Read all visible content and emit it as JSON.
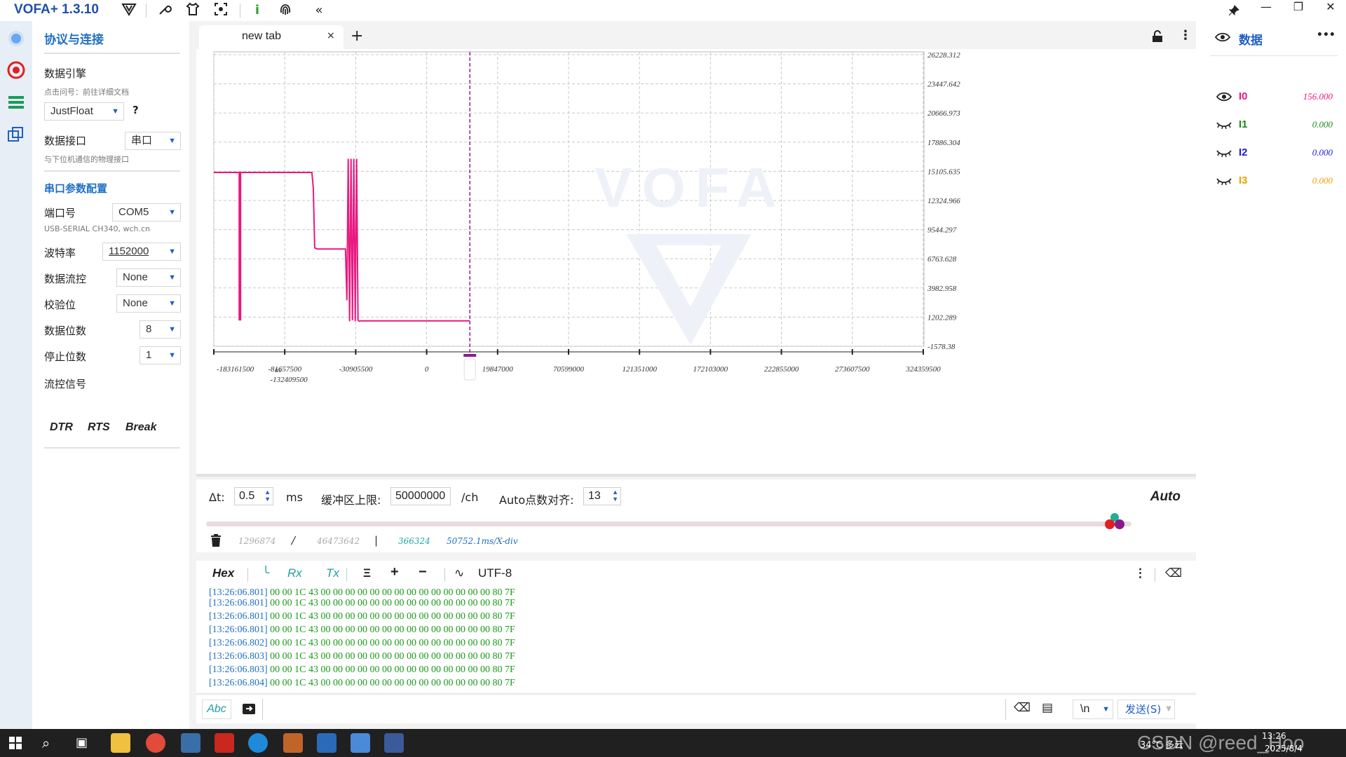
{
  "app": {
    "title": "VOFA+ 1.3.10"
  },
  "left": {
    "section_protocol": "协议与连接",
    "engine_label": "数据引擎",
    "engine_hint": "点击问号：前往详细文档",
    "engine_value": "JustFloat",
    "help": "?",
    "iface_label": "数据接口",
    "iface_value": "串口",
    "iface_hint": "与下位机通信的物理接口",
    "serial_section": "串口参数配置",
    "port_label": "端口号",
    "port_value": "COM5",
    "port_desc": "USB-SERIAL CH340, wch.cn",
    "baud_label": "波特率",
    "baud_value": "1152000",
    "flow_label": "数据流控",
    "flow_value": "None",
    "parity_label": "校验位",
    "parity_value": "None",
    "databits_label": "数据位数",
    "databits_value": "8",
    "stopbits_label": "停止位数",
    "stopbits_value": "1",
    "signal_label": "流控信号",
    "dtr": "DTR",
    "rts": "RTS",
    "break": "Break"
  },
  "tab": {
    "label": "new tab",
    "close": "×",
    "add": "+"
  },
  "chart_data": {
    "type": "line",
    "watermark": "VOFA",
    "y_ticks": [
      "26228.312",
      "23447.642",
      "20666.973",
      "17886.304",
      "15105.635",
      "12324.966",
      "9544.297",
      "6763.628",
      "3982.958",
      "1202.289",
      "-1578.38"
    ],
    "x_ticks_top": [
      "-183161500",
      "-81657500",
      "-30905500",
      "0",
      "19847000",
      "70599000",
      "121351000",
      "172103000",
      "222855000",
      "273607500",
      "324359500"
    ],
    "x_tick_lower": "-132409500",
    "x_unit": "us",
    "ylim": [
      -1578.38,
      26228.312
    ],
    "xlim": [
      -183161500,
      324359500
    ],
    "cursor_x": 0,
    "series": [
      {
        "color": "#e8197f",
        "x": [
          -183161500,
          -165000000,
          -165000000,
          -164000000,
          -164000000,
          -113000000,
          -112000000,
          -111000000,
          -109000000,
          -89000000,
          -88000000,
          -87000000,
          -86000000,
          -85000000,
          -84000000,
          -83000000,
          -82000000,
          -81000000,
          -80000000,
          -79000000,
          -78000000,
          0
        ],
        "y": [
          15000,
          15000,
          950,
          950,
          15000,
          15000,
          13500,
          7800,
          7700,
          7700,
          2800,
          16300,
          800,
          16300,
          900,
          16300,
          800,
          16300,
          900,
          800,
          850,
          850
        ]
      }
    ]
  },
  "controls": {
    "dt_label": "Δt:",
    "dt_value": "0.5",
    "dt_unit": "ms",
    "buffer_label": "缓冲区上限:",
    "buffer_value": "50000000",
    "buffer_unit": "/ch",
    "autoalign_label": "Auto点数对齐:",
    "autoalign_value": "13",
    "auto": "Auto"
  },
  "stats": {
    "a": "1296874",
    "sep1": "/",
    "b": "46473642",
    "sep2": "|",
    "c": "366324",
    "rate": "50752.1ms/X-div"
  },
  "raw_toolbar": {
    "hex": "Hex",
    "rx": "Rx",
    "tx": "Tx",
    "encoding": "UTF-8"
  },
  "log": [
    {
      "ts": "[13:26:06.801]",
      "data": " 00 00 1C 43 00 00 00 00 00 00 00 00 00 00 00 00 00 00 80 7F"
    },
    {
      "ts": "[13:26:06.801]",
      "data": " 00 00 1C 43 00 00 00 00 00 00 00 00 00 00 00 00 00 00 80 7F"
    },
    {
      "ts": "[13:26:06.801]",
      "data": " 00 00 1C 43 00 00 00 00 00 00 00 00 00 00 00 00 00 00 80 7F"
    },
    {
      "ts": "[13:26:06.801]",
      "data": " 00 00 1C 43 00 00 00 00 00 00 00 00 00 00 00 00 00 00 80 7F"
    },
    {
      "ts": "[13:26:06.802]",
      "data": " 00 00 1C 43 00 00 00 00 00 00 00 00 00 00 00 00 00 00 80 7F"
    },
    {
      "ts": "[13:26:06.803]",
      "data": " 00 00 1C 43 00 00 00 00 00 00 00 00 00 00 00 00 00 00 80 7F"
    },
    {
      "ts": "[13:26:06.803]",
      "data": " 00 00 1C 43 00 00 00 00 00 00 00 00 00 00 00 00 00 00 80 7F"
    },
    {
      "ts": "[13:26:06.804]",
      "data": " 00 00 1C 43 00 00 00 00 00 00 00 00 00 00 00 00 00 00 80 7F"
    }
  ],
  "send": {
    "format": "Abc",
    "newline": "\\n",
    "send_label": "发送(S)"
  },
  "right": {
    "title": "数据",
    "more": "•••",
    "channels": [
      {
        "name": "I0",
        "value": "156.000",
        "color": "#e8197f",
        "visible": true
      },
      {
        "name": "I1",
        "value": "0.000",
        "color": "#1a8a1a",
        "visible": false
      },
      {
        "name": "I2",
        "value": "0.000",
        "color": "#1a1adb",
        "visible": false
      },
      {
        "name": "I3",
        "value": "0.000",
        "color": "#f0a000",
        "visible": false
      }
    ]
  },
  "taskbar": {
    "weather": "34°C 多云",
    "time": "13:26",
    "date": "2025/8/4",
    "watermark": "CSDN @reed_Hoo"
  }
}
